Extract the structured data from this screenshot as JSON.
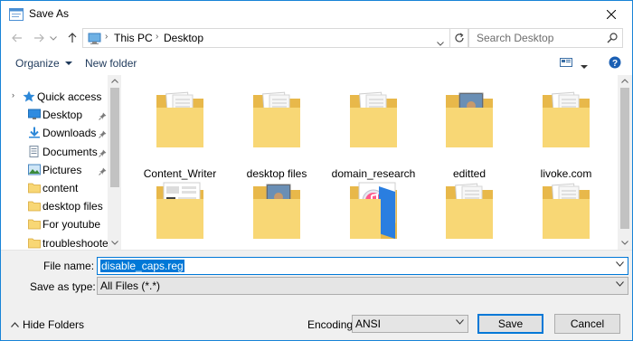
{
  "window": {
    "title": "Save As",
    "close_icon": "close-icon"
  },
  "address": {
    "crumbs": [
      "This PC",
      "Desktop"
    ],
    "search_placeholder": "Search Desktop"
  },
  "toolbar": {
    "organize_label": "Organize",
    "new_folder_label": "New folder"
  },
  "nav": {
    "items": [
      {
        "label": "Quick access",
        "icon": "star-icon",
        "pinned": false
      },
      {
        "label": "Desktop",
        "icon": "desktop-icon",
        "pinned": true
      },
      {
        "label": "Downloads",
        "icon": "download-icon",
        "pinned": true
      },
      {
        "label": "Documents",
        "icon": "documents-icon",
        "pinned": true
      },
      {
        "label": "Pictures",
        "icon": "pictures-icon",
        "pinned": true
      },
      {
        "label": "content",
        "icon": "folder-icon",
        "pinned": false
      },
      {
        "label": "desktop files",
        "icon": "folder-icon",
        "pinned": false
      },
      {
        "label": "For youtube",
        "icon": "folder-icon",
        "pinned": false
      },
      {
        "label": "troubleshooter",
        "icon": "folder-icon",
        "pinned": false
      }
    ]
  },
  "files": [
    {
      "label": "Content_Writer",
      "kind": "folder-docs"
    },
    {
      "label": "desktop files",
      "kind": "folder-docs"
    },
    {
      "label": "domain_research",
      "kind": "folder-docs"
    },
    {
      "label": "editted",
      "kind": "folder-photo"
    },
    {
      "label": "livoke.com",
      "kind": "folder-docs"
    },
    {
      "label": "",
      "kind": "folder-web"
    },
    {
      "label": "",
      "kind": "folder-photo"
    },
    {
      "label": "",
      "kind": "folder-itunes"
    },
    {
      "label": "",
      "kind": "folder-docs"
    },
    {
      "label": "",
      "kind": "folder-docs"
    }
  ],
  "form": {
    "file_name_label": "File name:",
    "file_name_value": "disable_caps.reg",
    "save_type_label": "Save as type:",
    "save_type_value": "All Files  (*.*)",
    "encoding_label": "Encoding:",
    "encoding_value": "ANSI",
    "save_label": "Save",
    "cancel_label": "Cancel",
    "hide_folders_label": "Hide Folders"
  },
  "colors": {
    "accent": "#0078d7",
    "folder": "#f8d775",
    "folder_dark": "#e8b84a",
    "toolbar_text": "#1e395b"
  }
}
